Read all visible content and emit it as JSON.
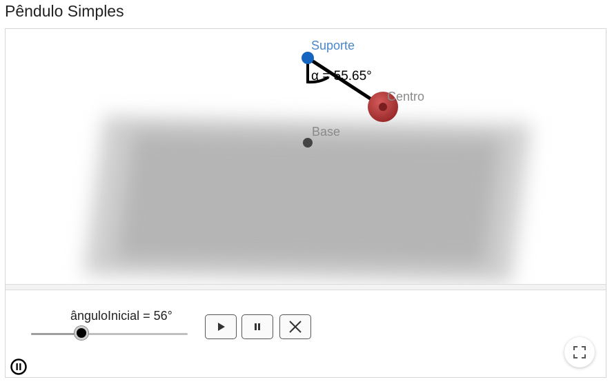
{
  "page": {
    "title": "Pêndulo Simples"
  },
  "scene": {
    "support_label": "Suporte",
    "center_label": "Centro",
    "base_label": "Base",
    "angle_label": "α = 55.65°",
    "colors": {
      "support_point": "#1565c0",
      "support_text": "#4a86c8",
      "bob": "#b23a3a",
      "plane": "#b3b3b3",
      "base_point": "#444444",
      "rod": "#000000"
    }
  },
  "controls": {
    "slider_label": "ânguloInicial = 56°",
    "slider_value_fraction": 0.32,
    "buttons": [
      {
        "name": "play",
        "icon": "play-icon"
      },
      {
        "name": "pause",
        "icon": "pause-icon"
      },
      {
        "name": "reset",
        "icon": "close-icon"
      }
    ],
    "animation_toggle_icon": "pause-circle-icon",
    "fullscreen_icon": "fullscreen-icon"
  }
}
